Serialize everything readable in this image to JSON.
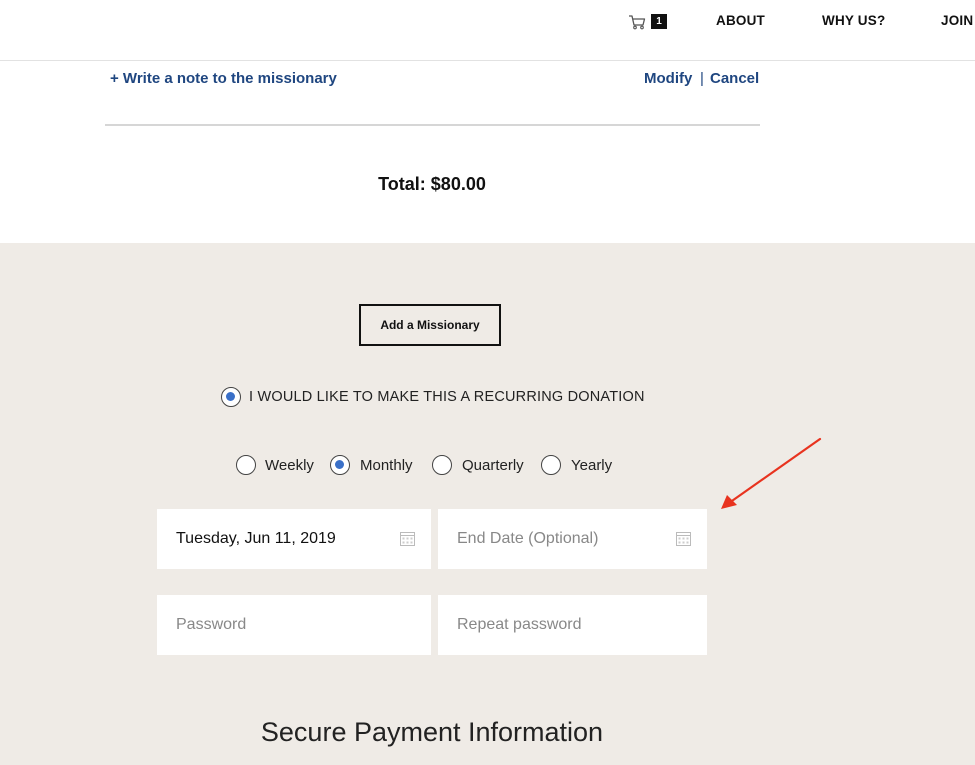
{
  "header": {
    "cart_count": "1",
    "nav": [
      "ABOUT",
      "WHY US?",
      "JOIN"
    ]
  },
  "order": {
    "note_link": "+ Write a note to the missionary",
    "modify": "Modify",
    "separator": "|",
    "cancel": "Cancel",
    "total": "Total: $80.00"
  },
  "form": {
    "add_missionary_button": "Add a Missionary",
    "recurring_label": "I WOULD LIKE TO MAKE THIS A RECURRING DONATION",
    "recurring_checked": true,
    "frequencies": [
      "Weekly",
      "Monthly",
      "Quarterly",
      "Yearly"
    ],
    "selected_frequency": "Monthly",
    "start_date_value": "Tuesday, Jun 11, 2019",
    "end_date_placeholder": "End Date (Optional)",
    "password_placeholder": "Password",
    "repeat_password_placeholder": "Repeat password",
    "payment_title": "Secure Payment Information"
  },
  "colors": {
    "link": "#1f4680",
    "radio_selected": "#3a70c8",
    "section_bg": "#efebe6",
    "annotation_arrow": "#e8331f"
  },
  "icons": [
    "cart-icon",
    "calendar-icon",
    "annotation-arrow"
  ]
}
